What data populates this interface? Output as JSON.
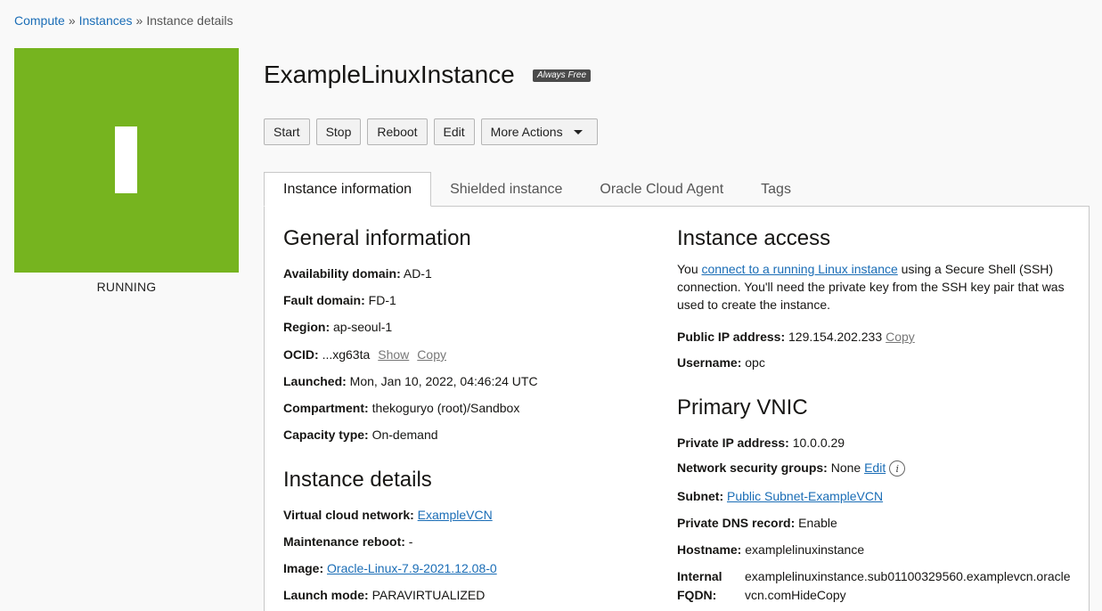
{
  "breadcrumb": {
    "compute": "Compute",
    "instances": "Instances",
    "current": "Instance details",
    "sep": "»"
  },
  "status": {
    "label": "RUNNING",
    "color": "#76b41f"
  },
  "title": "ExampleLinuxInstance",
  "badge": "Always Free",
  "actions": {
    "start": "Start",
    "stop": "Stop",
    "reboot": "Reboot",
    "edit": "Edit",
    "more": "More Actions"
  },
  "tabs": [
    "Instance information",
    "Shielded instance",
    "Oracle Cloud Agent",
    "Tags"
  ],
  "general": {
    "heading": "General information",
    "availability_label": "Availability domain:",
    "availability": "AD-1",
    "fault_label": "Fault domain:",
    "fault": "FD-1",
    "region_label": "Region:",
    "region": "ap-seoul-1",
    "ocid_label": "OCID:",
    "ocid": "...xg63ta",
    "show": "Show",
    "copy": "Copy",
    "launched_label": "Launched:",
    "launched": "Mon, Jan 10, 2022, 04:46:24 UTC",
    "compartment_label": "Compartment:",
    "compartment": "thekoguryo (root)/Sandbox",
    "capacity_label": "Capacity type:",
    "capacity": "On-demand"
  },
  "details": {
    "heading": "Instance details",
    "vcn_label": "Virtual cloud network:",
    "vcn": "ExampleVCN",
    "reboot_label": "Maintenance reboot:",
    "reboot": "-",
    "image_label": "Image:",
    "image": "Oracle-Linux-7.9-2021.12.08-0",
    "launch_label": "Launch mode:",
    "launch": "PARAVIRTUALIZED"
  },
  "access": {
    "heading": "Instance access",
    "text_pre": "You ",
    "link": "connect to a running Linux instance",
    "text_post": " using a Secure Shell (SSH) connection. You'll need the private key from the SSH key pair that was used to create the instance.",
    "public_ip_label": "Public IP address:",
    "public_ip": "129.154.202.233",
    "copy": "Copy",
    "username_label": "Username:",
    "username": "opc"
  },
  "vnic": {
    "heading": "Primary VNIC",
    "private_ip_label": "Private IP address:",
    "private_ip": "10.0.0.29",
    "nsg_label": "Network security groups:",
    "nsg": "None",
    "nsg_edit": "Edit",
    "info_glyph": "i",
    "subnet_label": "Subnet:",
    "subnet": "Public Subnet-ExampleVCN",
    "dns_label": "Private DNS record:",
    "dns": "Enable",
    "hostname_label": "Hostname:",
    "hostname": "examplelinuxinstance",
    "fqdn_label_1": "Internal",
    "fqdn_label_2": "FQDN:",
    "fqdn_line1": "examplelinuxinstance.sub01100329560.examplevcn.oracle",
    "fqdn_line2": "vcn.com",
    "hide": "Hide",
    "copy": "Copy"
  }
}
